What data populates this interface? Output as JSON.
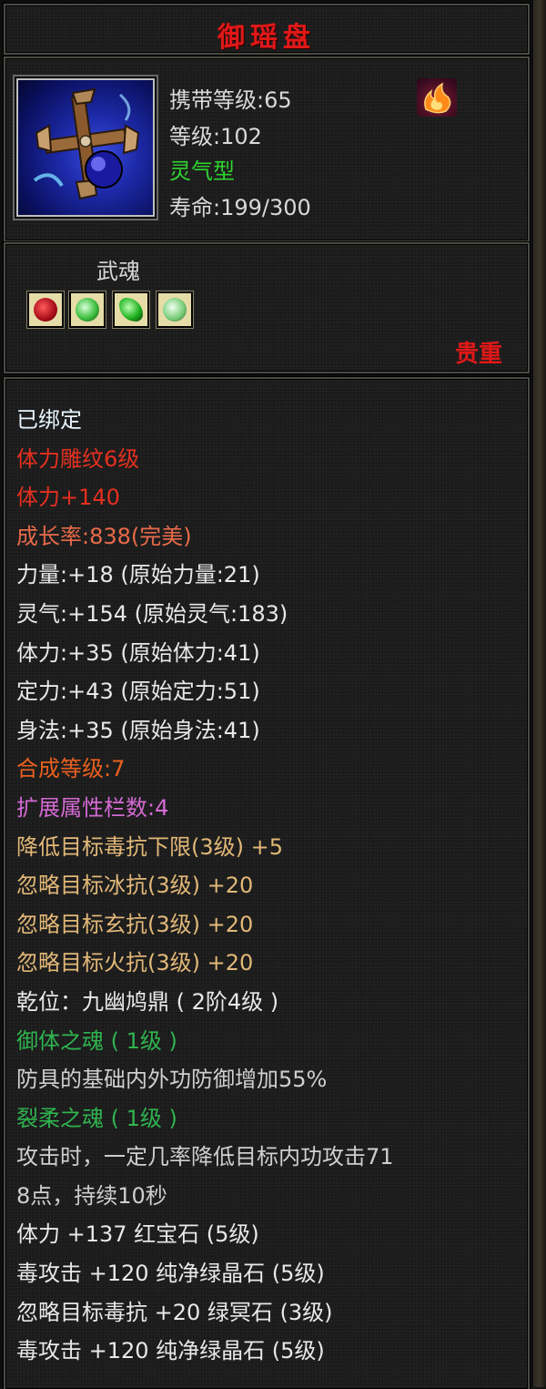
{
  "item": {
    "name": "御瑶盘",
    "carry_level": "携带等级:65",
    "level": "等级:102",
    "type": "灵气型",
    "lifespan": "寿命:199/300",
    "soul_label": "武魂",
    "rarity": "贵重",
    "icon": "crossed-blades-orb-icon",
    "element_icon": "fire-icon"
  },
  "colors": {
    "title": "#e01818",
    "green": "#2fd42f",
    "gold": "#e2b878",
    "pink": "#d46ad4"
  },
  "stats": [
    {
      "text": "已绑定",
      "color": "c-cyan"
    },
    {
      "text": "体力雕纹6级",
      "color": "c-red"
    },
    {
      "text": "体力+140",
      "color": "c-red"
    },
    {
      "text": "成长率:838(完美)",
      "color": "c-salmon"
    },
    {
      "text": "力量:+18 (原始力量:21)",
      "color": "c-white"
    },
    {
      "text": "灵气:+154 (原始灵气:183)",
      "color": "c-white"
    },
    {
      "text": "体力:+35 (原始体力:41)",
      "color": "c-white"
    },
    {
      "text": "定力:+43 (原始定力:51)",
      "color": "c-white"
    },
    {
      "text": "身法:+35 (原始身法:41)",
      "color": "c-white"
    },
    {
      "text": "合成等级:7",
      "color": "c-orange"
    },
    {
      "text": "扩展属性栏数:4",
      "color": "c-pink"
    },
    {
      "text": "降低目标毒抗下限(3级) +5",
      "color": "c-gold"
    },
    {
      "text": "忽略目标冰抗(3级) +20",
      "color": "c-gold"
    },
    {
      "text": "忽略目标玄抗(3级) +20",
      "color": "c-gold"
    },
    {
      "text": "忽略目标火抗(3级) +20",
      "color": "c-gold"
    },
    {
      "text": "乾位：九幽鸠鼎 ( 2阶4级 )",
      "color": "c-white"
    },
    {
      "text": "御体之魂 ( 1级 )",
      "color": "c-green"
    },
    {
      "text": "防具的基础内外功防御增加55%",
      "color": "c-grey"
    },
    {
      "text": "裂柔之魂 ( 1级 )",
      "color": "c-green"
    },
    {
      "text": "攻击时，一定几率降低目标内功攻击71",
      "color": "c-grey"
    },
    {
      "text": "8点，持续10秒",
      "color": "c-grey"
    },
    {
      "text": "体力 +137 红宝石 (5级)",
      "color": "c-white"
    },
    {
      "text": "毒攻击 +120 纯净绿晶石 (5级)",
      "color": "c-white"
    },
    {
      "text": "忽略目标毒抗 +20 绿冥石 (3级)",
      "color": "c-white"
    },
    {
      "text": "毒攻击 +120 纯净绿晶石 (5级)",
      "color": "c-white"
    }
  ]
}
